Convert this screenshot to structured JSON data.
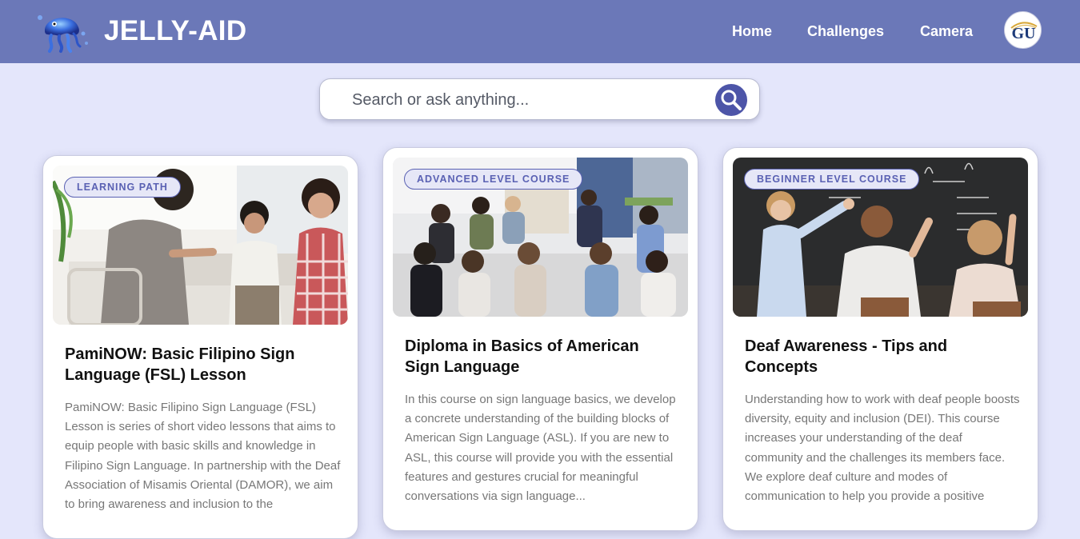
{
  "header": {
    "brand": "JELLY-AID",
    "nav": [
      {
        "label": "Home"
      },
      {
        "label": "Challenges"
      },
      {
        "label": "Camera"
      }
    ],
    "avatar_text": "GU",
    "logo_icon": "jellyfish-logo-icon"
  },
  "search": {
    "placeholder": "Search or ask anything...",
    "button_icon": "search-icon"
  },
  "cards": [
    {
      "badge": "LEARNING PATH",
      "title": "PamiNOW: Basic Filipino Sign Language (FSL) Lesson",
      "description": "PamiNOW: Basic Filipino Sign Language (FSL) Lesson is series of short video lessons that aims to equip people with basic skills and knowledge in Filipino Sign Language. In partnership with the Deaf Association of Misamis Oriental (DAMOR), we aim to bring awareness and inclusion to the"
    },
    {
      "badge": "ADVANCED LEVEL COURSE",
      "title": "Diploma in Basics of American Sign Language",
      "description": "In this course on sign language basics, we develop a concrete understanding of the building blocks of American Sign Language (ASL). If you are new to ASL, this course will provide you with the essential features and gestures crucial for meaningful conversations via sign language..."
    },
    {
      "badge": "BEGINNER LEVEL COURSE",
      "title": "Deaf Awareness - Tips and Concepts",
      "description": "Understanding how to work with deaf people boosts diversity, equity and inclusion (DEI). This course increases your understanding of the deaf community and the challenges its members face. We explore deaf culture and modes of communication to help you provide a positive"
    }
  ],
  "colors": {
    "header_bg": "#6b78b8",
    "page_bg": "#e4e6fb",
    "accent": "#5a61b3",
    "search_button": "#4d55a8"
  }
}
